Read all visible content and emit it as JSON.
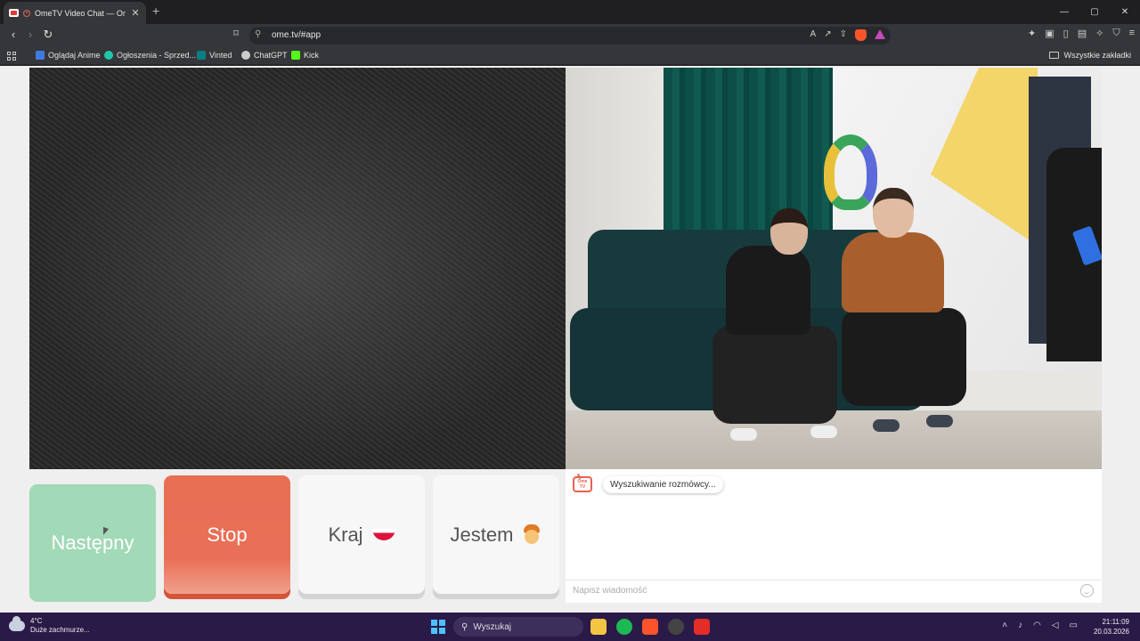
{
  "browser": {
    "tab_title": "OmeTV Video Chat — Omeg",
    "new_tab": "+",
    "close_tab": "✕",
    "url": "ome.tv/#app",
    "window_controls": [
      "—",
      "▢",
      "✕"
    ],
    "bookmarks": [
      {
        "label": "Oglądaj Anime",
        "icon_color": "#3f7ae0"
      },
      {
        "label": "Ogłoszenia - Sprzed...",
        "icon_color": "#21c7a8"
      },
      {
        "label": "Vinted",
        "icon_color": "#0b7f86"
      },
      {
        "label": "ChatGPT",
        "icon_color": "#cccccc"
      },
      {
        "label": "Kick",
        "icon_color": "#53fc18"
      }
    ],
    "all_bookmarks": "Wszystkie zakładki"
  },
  "controls": {
    "next_label": "Następny",
    "stop_label": "Stop",
    "country_label": "Kraj",
    "me_label": "Jestem"
  },
  "chat": {
    "logo_text": "Ome TV",
    "status_message": "Wyszukiwanie rozmówcy...",
    "input_placeholder": "Napisz wiadomość"
  },
  "taskbar": {
    "temperature": "4°C",
    "weather": "Duże zachmurze...",
    "search_label": "Wyszukaj",
    "time": "21:11:09",
    "date": "20.03.2026"
  },
  "colors": {
    "next": "#a2d9b6",
    "stop": "#e86e54",
    "accent_brand": "#e8624e"
  }
}
